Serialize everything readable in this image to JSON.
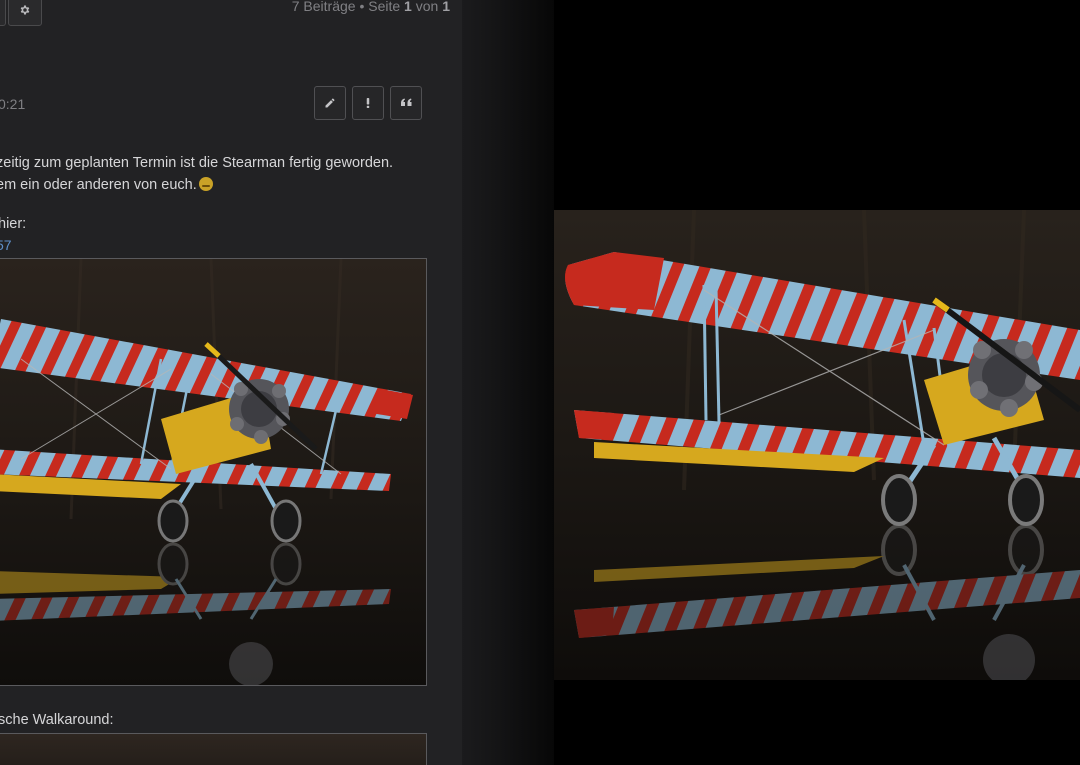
{
  "forum": {
    "pagination": {
      "prefix": "7 Beiträge • Seite ",
      "current": "1",
      "middle": " von ",
      "total": "1"
    },
    "post": {
      "time": "0:21",
      "actions": [
        "pencil-icon",
        "exclamation-icon",
        "quote-icon"
      ],
      "lines": [
        "zeitig zum geplanten Termin ist die Stearman fertig geworden.",
        "em ein oder anderen von euch."
      ],
      "label_hier": "hier:",
      "link_text": "57",
      "label_walkaround": "sche Walkaround:"
    }
  },
  "colors": {
    "panel_bg": "#222224",
    "text": "#d6d6d8",
    "muted": "#808084",
    "link": "#5f8fc9",
    "wing_blue": "#8ab8d4",
    "wing_red": "#c8281c",
    "fuselage_yellow": "#d6a81e"
  },
  "lightbox": {
    "subject": "Stearman biplane model photo"
  }
}
